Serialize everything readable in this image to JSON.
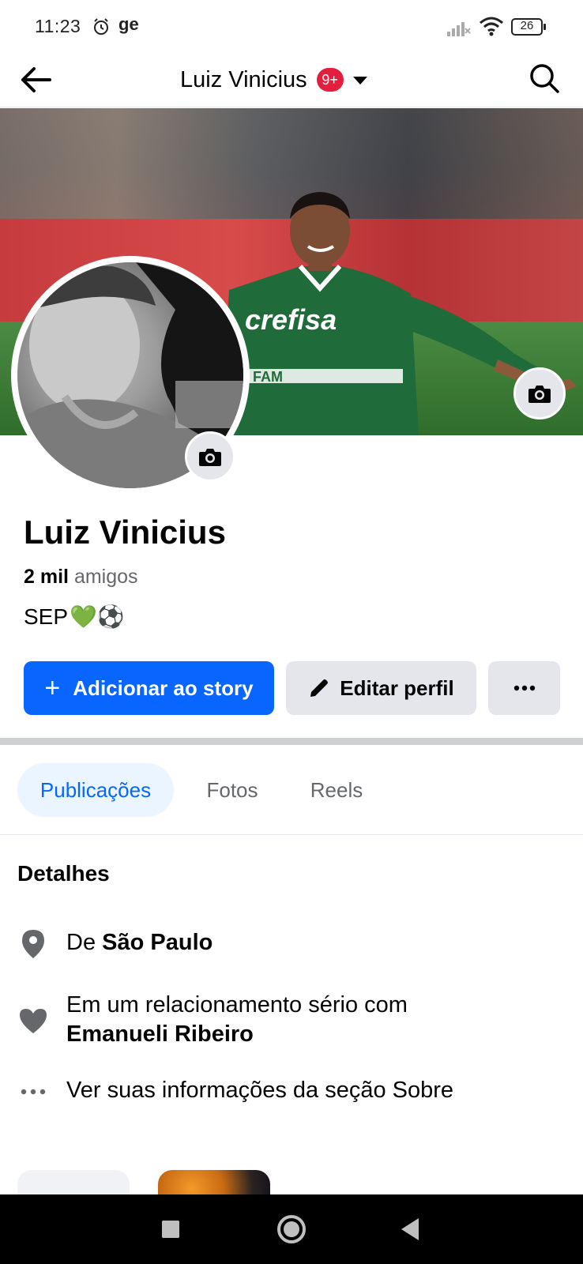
{
  "status_bar": {
    "time": "11:23",
    "carrier": "ge",
    "battery": "26"
  },
  "header": {
    "title": "Luiz Vinicius",
    "badge": "9+"
  },
  "profile": {
    "name": "Luiz Vinicius",
    "friends_count": "2 mil",
    "friends_label": "amigos",
    "bio_text": "SEP",
    "bio_emojis": "💚⚽"
  },
  "actions": {
    "add_story_label": "Adicionar ao story",
    "edit_profile_label": "Editar perfil"
  },
  "tabs": [
    {
      "label": "Publicações",
      "active": true
    },
    {
      "label": "Fotos",
      "active": false
    },
    {
      "label": "Reels",
      "active": false
    }
  ],
  "details": {
    "title": "Detalhes",
    "location_prefix": "De",
    "location_value": "São Paulo",
    "relationship_prefix": "Em um relacionamento sério com",
    "relationship_partner": "Emanueli Ribeiro",
    "about_link": "Ver suas informações da seção Sobre"
  },
  "icons": {
    "back": "arrow-left-icon",
    "dropdown": "caret-down-icon",
    "search": "search-icon",
    "cover_camera": "camera-icon",
    "avatar_camera": "camera-icon",
    "edit": "pencil-icon",
    "more": "more-horizontal-icon",
    "location": "location-pin-icon",
    "relationship": "heart-icon",
    "about": "ellipsis-icon"
  },
  "colors": {
    "primary": "#0866ff",
    "badge": "#e41e3f",
    "secondary_button": "#e4e6eb",
    "active_tab_bg": "#ebf5ff",
    "muted_text": "#65676b"
  }
}
